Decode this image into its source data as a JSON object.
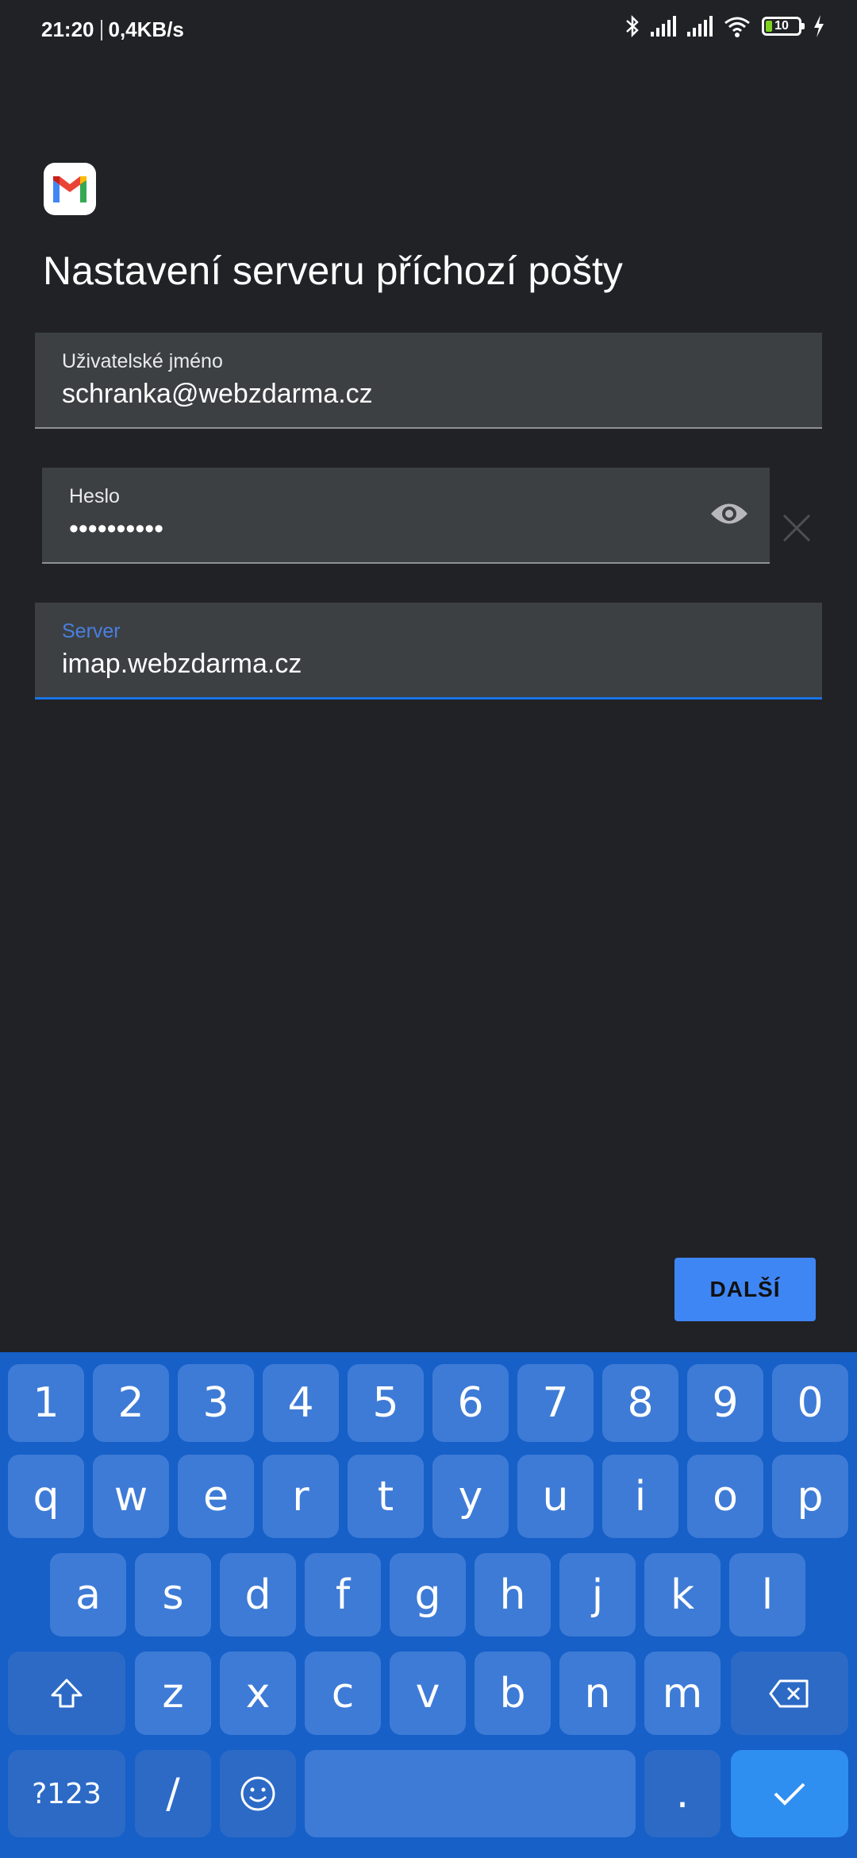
{
  "status_bar": {
    "time": "21:20",
    "speed": "0,4KB/s",
    "battery": "10",
    "icons": [
      "bluetooth-icon",
      "signal-icon",
      "signal-icon",
      "wifi-icon",
      "battery-icon",
      "charging-icon"
    ]
  },
  "app": {
    "logo": "gmail-logo",
    "title": "Nastavení serveru příchozí pošty"
  },
  "form": {
    "username": {
      "label": "Uživatelské jméno",
      "value": "schranka@webzdarma.cz"
    },
    "password": {
      "label": "Heslo",
      "value": "••••••••••"
    },
    "server": {
      "label": "Server",
      "value": "imap.webzdarma.cz"
    }
  },
  "actions": {
    "next_label": "DALŠÍ"
  },
  "colors": {
    "accent": "#1a73e8",
    "button": "#3f86f5",
    "background": "#212226",
    "field": "#3c4043",
    "keyboard": "#1660c8"
  },
  "keyboard": {
    "row1": [
      "1",
      "2",
      "3",
      "4",
      "5",
      "6",
      "7",
      "8",
      "9",
      "0"
    ],
    "row2": [
      "q",
      "w",
      "e",
      "r",
      "t",
      "y",
      "u",
      "i",
      "o",
      "p"
    ],
    "row3": [
      "a",
      "s",
      "d",
      "f",
      "g",
      "h",
      "j",
      "k",
      "l"
    ],
    "row4": [
      "z",
      "x",
      "c",
      "v",
      "b",
      "n",
      "m"
    ],
    "symbols_label": "?123",
    "slash": "/",
    "period": "."
  }
}
